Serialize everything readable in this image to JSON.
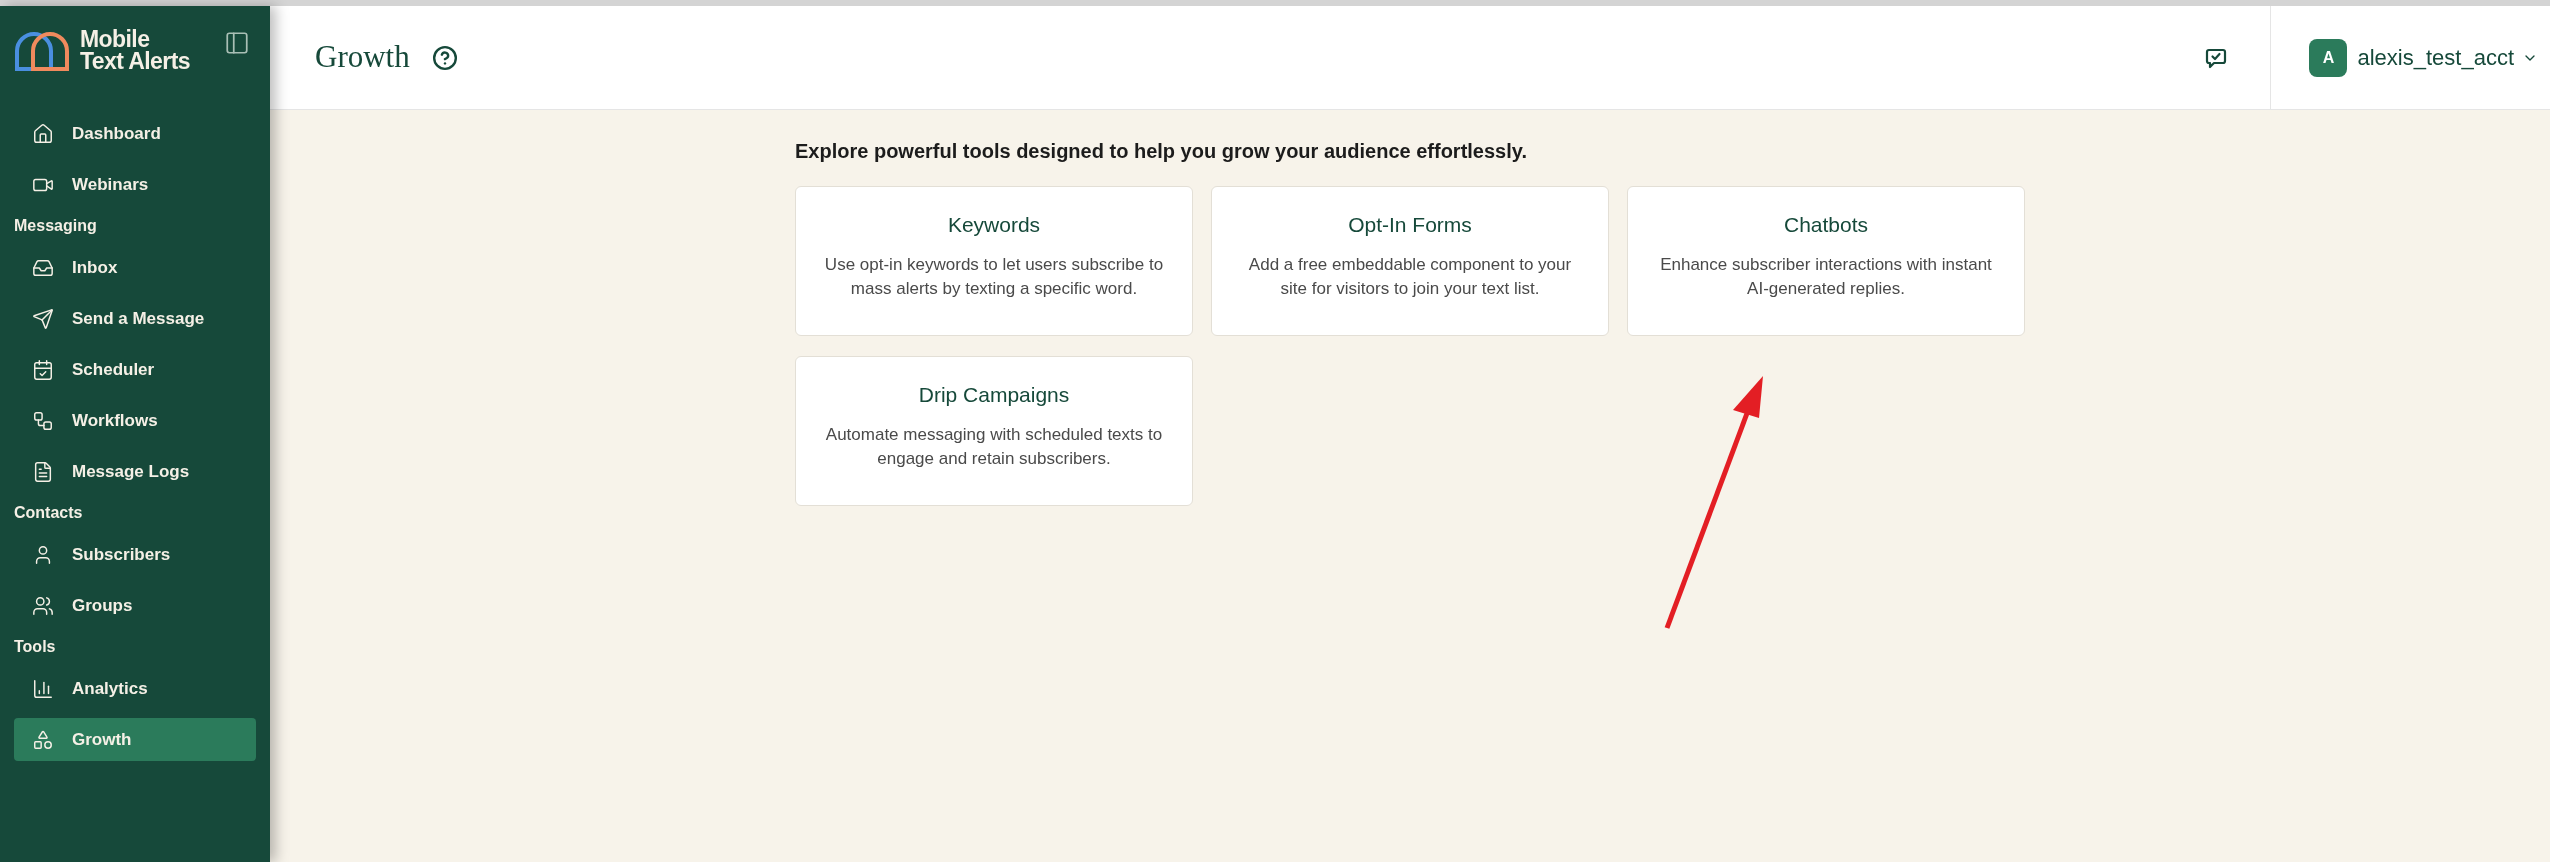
{
  "brand": {
    "name_line_1": "Mobile",
    "name_line_2": "Text Alerts"
  },
  "sidebar": {
    "sections": [
      {
        "items": [
          {
            "label": "Dashboard",
            "selected": false
          },
          {
            "label": "Webinars",
            "selected": false
          }
        ]
      },
      {
        "title": "Messaging",
        "items": [
          {
            "label": "Inbox",
            "selected": false
          },
          {
            "label": "Send a Message",
            "selected": false
          },
          {
            "label": "Scheduler",
            "selected": false
          },
          {
            "label": "Workflows",
            "selected": false
          },
          {
            "label": "Message Logs",
            "selected": false
          }
        ]
      },
      {
        "title": "Contacts",
        "items": [
          {
            "label": "Subscribers",
            "selected": false
          },
          {
            "label": "Groups",
            "selected": false
          }
        ]
      },
      {
        "title": "Tools",
        "items": [
          {
            "label": "Analytics",
            "selected": false
          },
          {
            "label": "Growth",
            "selected": true
          }
        ]
      }
    ]
  },
  "header": {
    "title": "Growth",
    "user": {
      "initial": "A",
      "name": "alexis_test_acct"
    }
  },
  "intro": "Explore powerful tools designed to help you grow your audience effortlessly.",
  "cards": [
    {
      "title": "Keywords",
      "description": "Use opt-in keywords to let users subscribe to mass alerts by texting a specific word."
    },
    {
      "title": "Opt-In Forms",
      "description": "Add a free embeddable component to your site for visitors to join your text list."
    },
    {
      "title": "Chatbots",
      "description": "Enhance subscriber interactions with instant AI-generated replies."
    },
    {
      "title": "Drip Campaigns",
      "description": "Automate messaging with scheduled texts to engage and retain subscribers."
    }
  ]
}
